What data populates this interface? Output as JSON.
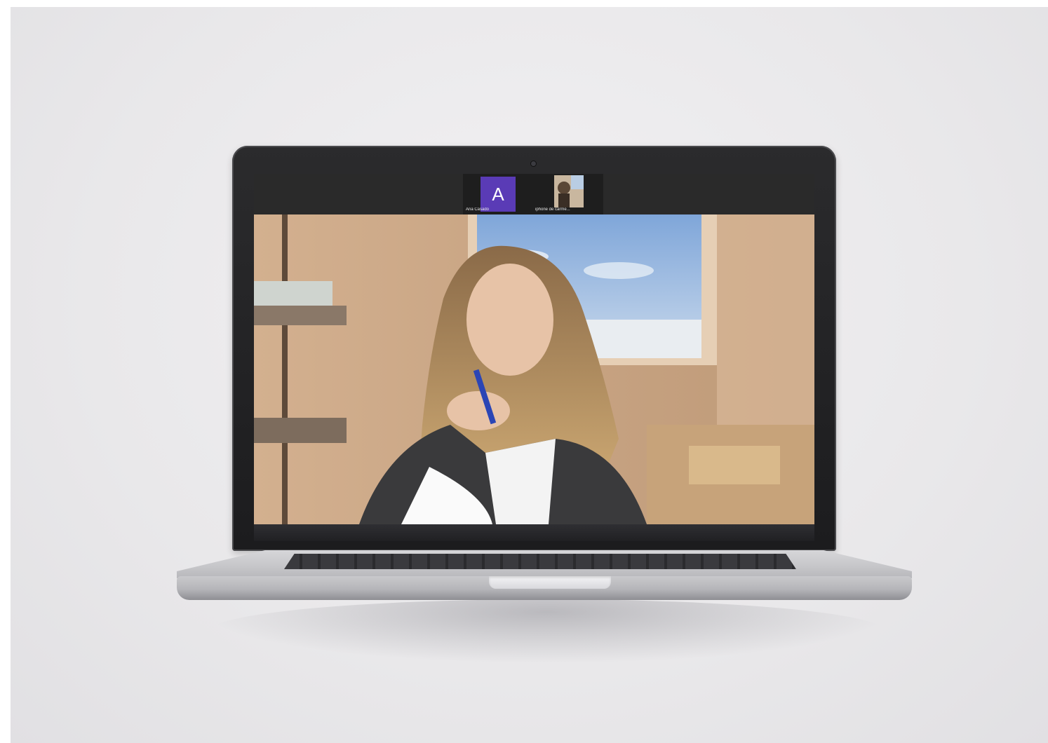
{
  "meeting": {
    "participants": [
      {
        "initial": "A",
        "name": "Ana Casado",
        "avatar_color": "#5a3bb6"
      },
      {
        "initial": "",
        "name": "iphone de carme..."
      }
    ],
    "main_speaker_video": "webcam-feed"
  },
  "colors": {
    "background": "#e9e8ea",
    "laptop_lid": "#1c1c1e",
    "app_bar": "#2a2a2a",
    "avatar": "#5a3bb6"
  }
}
